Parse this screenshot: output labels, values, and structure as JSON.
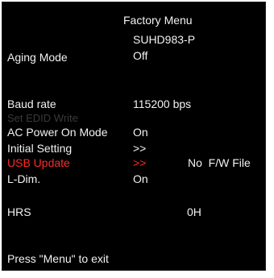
{
  "header": {
    "title": "Factory Menu",
    "model": "SUHD983-P"
  },
  "rows": [
    {
      "label": "Aging Mode",
      "value": "Off",
      "extra": ""
    },
    {
      "label": "Baud rate",
      "value": "115200 bps",
      "extra": ""
    },
    {
      "label": "Set EDID Write",
      "value": "",
      "extra": ""
    },
    {
      "label": "AC Power On Mode",
      "value": "On",
      "extra": ""
    },
    {
      "label": "Initial Setting",
      "value": ">>",
      "extra": ""
    },
    {
      "label": "USB Update",
      "value": ">>",
      "extra": "No  F/W File"
    },
    {
      "label": "L-Dim.",
      "value": "On",
      "extra": ""
    },
    {
      "label": "HRS",
      "value": "",
      "extra": "0H"
    }
  ],
  "footer": {
    "hint": "Press \"Menu\" to exit"
  },
  "colors": {
    "background": "#000000",
    "text": "#f2f2f2",
    "selected": "#ff2a2a",
    "disabled": "#3a3a3a"
  }
}
